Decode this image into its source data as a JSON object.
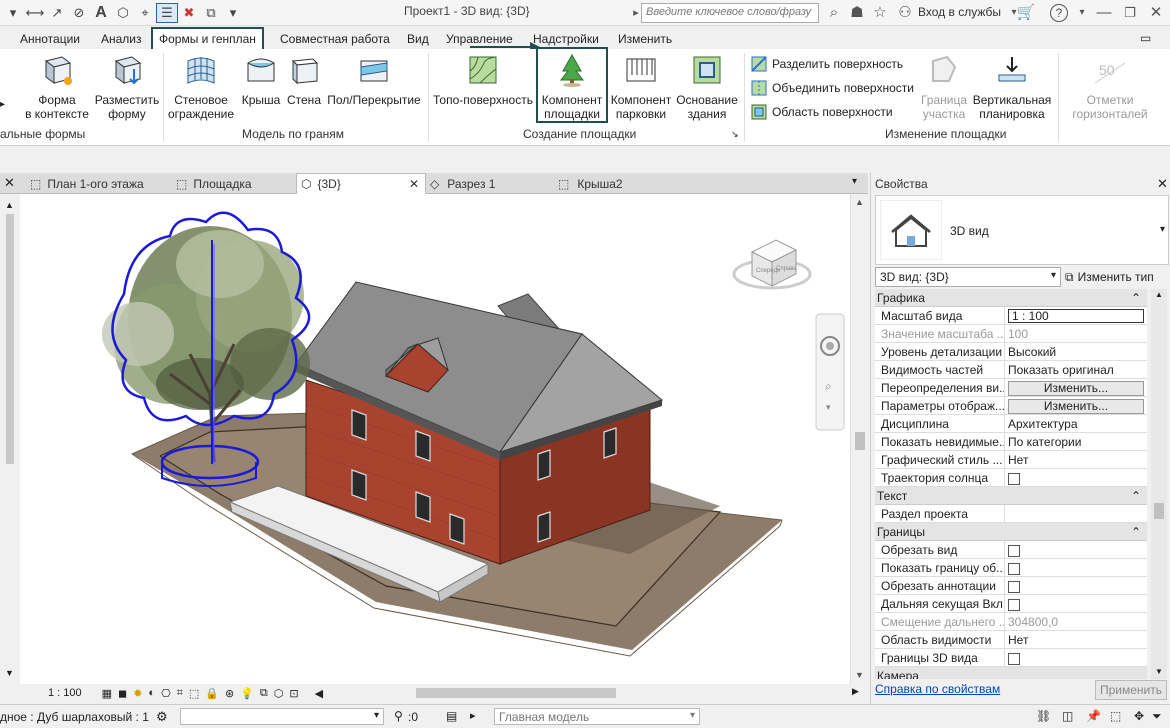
{
  "window": {
    "title": "Проект1 - 3D вид: {3D}",
    "search_placeholder": "Введите ключевое слово/фразу",
    "signin": "Вход в службы"
  },
  "tabs": [
    "Аннотации",
    "Анализ",
    "Формы и генплан",
    "Совместная работа",
    "Вид",
    "Управление",
    "Надстройки",
    "Изменить"
  ],
  "active_tab": "Формы и генплан",
  "ribbon": {
    "massing": {
      "label": "альные формы",
      "buttons": [
        {
          "l1": "Форма",
          "l2": "в контексте"
        },
        {
          "l1": "Разместить",
          "l2": "форму"
        }
      ]
    },
    "model_by_face": {
      "label": "Модель по граням",
      "buttons": [
        {
          "l1": "Стеновое",
          "l2": "ограждение"
        },
        {
          "l1": "Крыша",
          "l2": ""
        },
        {
          "l1": "Стена",
          "l2": ""
        },
        {
          "l1": "Пол/Перекрытие",
          "l2": ""
        }
      ]
    },
    "site": {
      "label": "Создание площадки",
      "buttons": [
        {
          "l1": "Топо-поверхность",
          "l2": ""
        },
        {
          "l1": "Компонент",
          "l2": "площадки"
        },
        {
          "l1": "Компонент",
          "l2": "парковки"
        },
        {
          "l1": "Основание",
          "l2": "здания"
        }
      ]
    },
    "modify_site": {
      "label": "Изменение площадки",
      "rows": [
        "Разделить поверхность",
        "Объединить поверхности",
        "Область поверхности"
      ],
      "buttons": [
        {
          "l1": "Граница",
          "l2": "участка"
        },
        {
          "l1": "Вертикальная",
          "l2": "планировка"
        },
        {
          "l1": "Отметки",
          "l2": "горизонталей"
        }
      ]
    }
  },
  "doc_tabs": [
    "План 1-ого этажа",
    "Площадка",
    "{3D}",
    "Разрез 1",
    "Крыша2"
  ],
  "view_scale": "1 : 100",
  "status": {
    "left": "дное : Дуб шарлаховый : 1",
    "zero": ":0",
    "model": "Главная модель"
  },
  "properties": {
    "title": "Свойства",
    "type_name": "3D вид",
    "selector": "3D вид: {3D}",
    "edit_type": "Изменить тип",
    "groups": [
      {
        "name": "Графика",
        "rows": [
          {
            "k": "Масштаб вида",
            "v": "1 : 100"
          },
          {
            "k": "Значение масштаба ...",
            "v": "100"
          },
          {
            "k": "Уровень детализации",
            "v": "Высокий"
          },
          {
            "k": "Видимость частей",
            "v": "Показать оригинал"
          },
          {
            "k": "Переопределения ви...",
            "v": "Изменить..."
          },
          {
            "k": "Параметры отображ...",
            "v": "Изменить..."
          },
          {
            "k": "Дисциплина",
            "v": "Архитектура"
          },
          {
            "k": "Показать невидимые...",
            "v": "По категории"
          },
          {
            "k": "Графический стиль ...",
            "v": "Нет"
          },
          {
            "k": "Траектория солнца",
            "v": ""
          }
        ]
      },
      {
        "name": "Текст",
        "rows": [
          {
            "k": "Раздел проекта",
            "v": ""
          }
        ]
      },
      {
        "name": "Границы",
        "rows": [
          {
            "k": "Обрезать вид",
            "v": ""
          },
          {
            "k": "Показать границу об...",
            "v": ""
          },
          {
            "k": "Обрезать аннотации",
            "v": ""
          },
          {
            "k": "Дальняя секущая Вкл",
            "v": ""
          },
          {
            "k": "Смещение дальнего ...",
            "v": "304800,0"
          },
          {
            "k": "Область видимости",
            "v": "Нет"
          },
          {
            "k": "Границы 3D вида",
            "v": ""
          }
        ]
      },
      {
        "name": "Камера",
        "rows": []
      }
    ],
    "help_link": "Справка по свойствам",
    "apply": "Применить"
  },
  "colors": {
    "accent": "#1f4f4f",
    "link": "#0645ad",
    "brick": "#a34030",
    "roof": "#8a8a8a",
    "ground": "#8c7a68"
  }
}
